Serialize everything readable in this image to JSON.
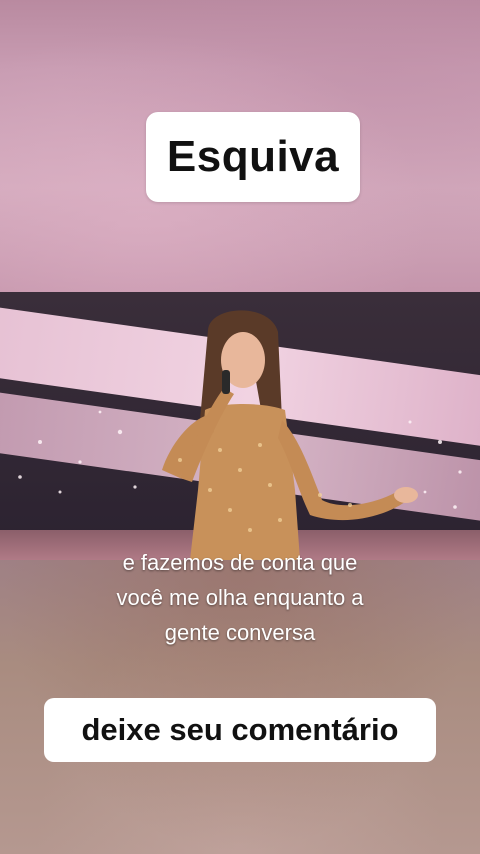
{
  "title": "Esquiva",
  "caption": {
    "lines": [
      "e fazemos de conta que",
      "você me olha enquanto a",
      "gente conversa"
    ]
  },
  "cta": "deixe seu comentário"
}
